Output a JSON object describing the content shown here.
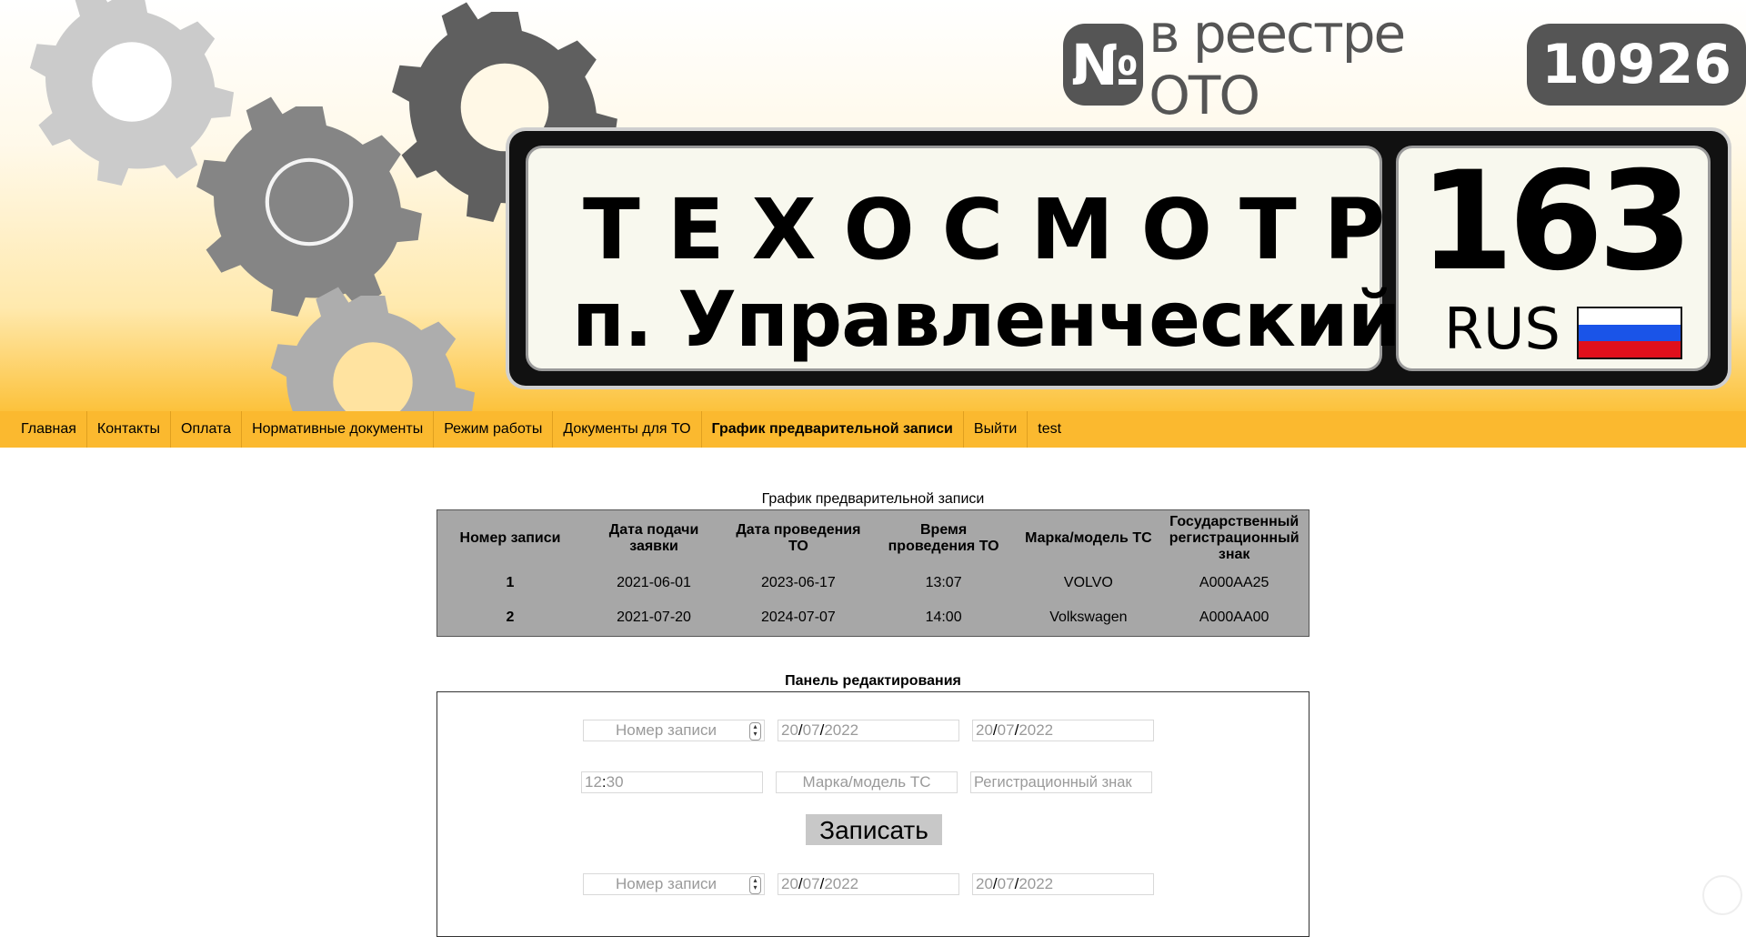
{
  "header": {
    "registry_no_symbol": "№",
    "registry_text": "в реестре ОТО",
    "registry_number": "10926",
    "plate_title": "ТЕХОСМОТР",
    "plate_subtitle": "п. Управленческий",
    "plate_region": "163",
    "plate_country": "RUS",
    "flag_colors": [
      "#ffffff",
      "#1a54e8",
      "#e0101c"
    ]
  },
  "nav": {
    "items": [
      {
        "label": "Главная"
      },
      {
        "label": "Контакты"
      },
      {
        "label": "Оплата"
      },
      {
        "label": "Нормативные документы"
      },
      {
        "label": "Режим работы"
      },
      {
        "label": "Документы для ТО"
      },
      {
        "label": "График предварительной записи",
        "active": true
      },
      {
        "label": "Выйти"
      },
      {
        "label": "test"
      }
    ]
  },
  "schedule": {
    "title": "График предварительной записи",
    "columns": [
      "Номер записи",
      "Дата подачи заявки",
      "Дата проведения ТО",
      "Время проведения ТО",
      "Марка/модель ТС",
      "Государственный регистрационный знак"
    ],
    "rows": [
      [
        "1",
        "2021-06-01",
        "2023-06-17",
        "13:07",
        "VOLVO",
        "A000AA25"
      ],
      [
        "2",
        "2021-07-20",
        "2024-07-07",
        "14:00",
        "Volkswagen",
        "A000AA00"
      ]
    ]
  },
  "edit_panel": {
    "title": "Панель редактирования",
    "row1": {
      "record_placeholder": "Номер записи",
      "date1": {
        "dd": "20",
        "mm": "07",
        "yyyy": "2022"
      },
      "date2": {
        "dd": "20",
        "mm": "07",
        "yyyy": "2022"
      }
    },
    "row2": {
      "time": {
        "hh": "12",
        "mm": "30"
      },
      "model_placeholder": "Марка/модель ТС",
      "plate_placeholder": "Регистрационный знак"
    },
    "submit_label": "Записать",
    "row3": {
      "record_placeholder": "Номер записи",
      "date1": {
        "dd": "20",
        "mm": "07",
        "yyyy": "2022"
      },
      "date2": {
        "dd": "20",
        "mm": "07",
        "yyyy": "2022"
      }
    }
  },
  "colors": {
    "nav_bg": "#fbb92f",
    "table_bg": "#a7a7a7",
    "gear_light": "#c9c9c9",
    "gear_mid": "#888888",
    "gear_dark": "#5f5f5f"
  }
}
